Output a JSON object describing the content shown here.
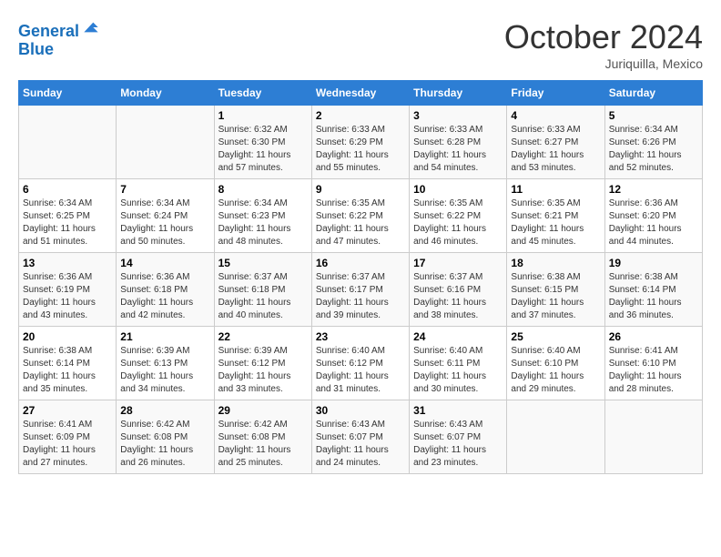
{
  "logo": {
    "line1": "General",
    "line2": "Blue"
  },
  "title": "October 2024",
  "location": "Juriquilla, Mexico",
  "days_of_week": [
    "Sunday",
    "Monday",
    "Tuesday",
    "Wednesday",
    "Thursday",
    "Friday",
    "Saturday"
  ],
  "weeks": [
    [
      {
        "day": "",
        "info": ""
      },
      {
        "day": "",
        "info": ""
      },
      {
        "day": "1",
        "info": "Sunrise: 6:32 AM\nSunset: 6:30 PM\nDaylight: 11 hours and 57 minutes."
      },
      {
        "day": "2",
        "info": "Sunrise: 6:33 AM\nSunset: 6:29 PM\nDaylight: 11 hours and 55 minutes."
      },
      {
        "day": "3",
        "info": "Sunrise: 6:33 AM\nSunset: 6:28 PM\nDaylight: 11 hours and 54 minutes."
      },
      {
        "day": "4",
        "info": "Sunrise: 6:33 AM\nSunset: 6:27 PM\nDaylight: 11 hours and 53 minutes."
      },
      {
        "day": "5",
        "info": "Sunrise: 6:34 AM\nSunset: 6:26 PM\nDaylight: 11 hours and 52 minutes."
      }
    ],
    [
      {
        "day": "6",
        "info": "Sunrise: 6:34 AM\nSunset: 6:25 PM\nDaylight: 11 hours and 51 minutes."
      },
      {
        "day": "7",
        "info": "Sunrise: 6:34 AM\nSunset: 6:24 PM\nDaylight: 11 hours and 50 minutes."
      },
      {
        "day": "8",
        "info": "Sunrise: 6:34 AM\nSunset: 6:23 PM\nDaylight: 11 hours and 48 minutes."
      },
      {
        "day": "9",
        "info": "Sunrise: 6:35 AM\nSunset: 6:22 PM\nDaylight: 11 hours and 47 minutes."
      },
      {
        "day": "10",
        "info": "Sunrise: 6:35 AM\nSunset: 6:22 PM\nDaylight: 11 hours and 46 minutes."
      },
      {
        "day": "11",
        "info": "Sunrise: 6:35 AM\nSunset: 6:21 PM\nDaylight: 11 hours and 45 minutes."
      },
      {
        "day": "12",
        "info": "Sunrise: 6:36 AM\nSunset: 6:20 PM\nDaylight: 11 hours and 44 minutes."
      }
    ],
    [
      {
        "day": "13",
        "info": "Sunrise: 6:36 AM\nSunset: 6:19 PM\nDaylight: 11 hours and 43 minutes."
      },
      {
        "day": "14",
        "info": "Sunrise: 6:36 AM\nSunset: 6:18 PM\nDaylight: 11 hours and 42 minutes."
      },
      {
        "day": "15",
        "info": "Sunrise: 6:37 AM\nSunset: 6:18 PM\nDaylight: 11 hours and 40 minutes."
      },
      {
        "day": "16",
        "info": "Sunrise: 6:37 AM\nSunset: 6:17 PM\nDaylight: 11 hours and 39 minutes."
      },
      {
        "day": "17",
        "info": "Sunrise: 6:37 AM\nSunset: 6:16 PM\nDaylight: 11 hours and 38 minutes."
      },
      {
        "day": "18",
        "info": "Sunrise: 6:38 AM\nSunset: 6:15 PM\nDaylight: 11 hours and 37 minutes."
      },
      {
        "day": "19",
        "info": "Sunrise: 6:38 AM\nSunset: 6:14 PM\nDaylight: 11 hours and 36 minutes."
      }
    ],
    [
      {
        "day": "20",
        "info": "Sunrise: 6:38 AM\nSunset: 6:14 PM\nDaylight: 11 hours and 35 minutes."
      },
      {
        "day": "21",
        "info": "Sunrise: 6:39 AM\nSunset: 6:13 PM\nDaylight: 11 hours and 34 minutes."
      },
      {
        "day": "22",
        "info": "Sunrise: 6:39 AM\nSunset: 6:12 PM\nDaylight: 11 hours and 33 minutes."
      },
      {
        "day": "23",
        "info": "Sunrise: 6:40 AM\nSunset: 6:12 PM\nDaylight: 11 hours and 31 minutes."
      },
      {
        "day": "24",
        "info": "Sunrise: 6:40 AM\nSunset: 6:11 PM\nDaylight: 11 hours and 30 minutes."
      },
      {
        "day": "25",
        "info": "Sunrise: 6:40 AM\nSunset: 6:10 PM\nDaylight: 11 hours and 29 minutes."
      },
      {
        "day": "26",
        "info": "Sunrise: 6:41 AM\nSunset: 6:10 PM\nDaylight: 11 hours and 28 minutes."
      }
    ],
    [
      {
        "day": "27",
        "info": "Sunrise: 6:41 AM\nSunset: 6:09 PM\nDaylight: 11 hours and 27 minutes."
      },
      {
        "day": "28",
        "info": "Sunrise: 6:42 AM\nSunset: 6:08 PM\nDaylight: 11 hours and 26 minutes."
      },
      {
        "day": "29",
        "info": "Sunrise: 6:42 AM\nSunset: 6:08 PM\nDaylight: 11 hours and 25 minutes."
      },
      {
        "day": "30",
        "info": "Sunrise: 6:43 AM\nSunset: 6:07 PM\nDaylight: 11 hours and 24 minutes."
      },
      {
        "day": "31",
        "info": "Sunrise: 6:43 AM\nSunset: 6:07 PM\nDaylight: 11 hours and 23 minutes."
      },
      {
        "day": "",
        "info": ""
      },
      {
        "day": "",
        "info": ""
      }
    ]
  ]
}
